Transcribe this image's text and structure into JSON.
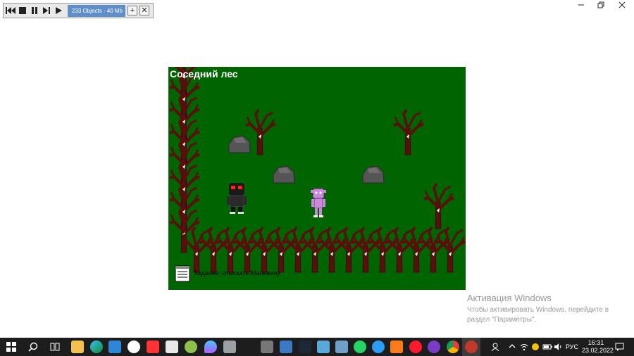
{
  "toolbar": {
    "status_text": "233 Objects - 40 Mb",
    "add_label": "+",
    "close_label": "✕"
  },
  "game": {
    "location_title": "Соседний лес",
    "hint_text": "Задание: отыскать Мальвину"
  },
  "activation": {
    "title": "Активация Windows",
    "line1": "Чтобы активировать Windows, перейдите в",
    "line2": "раздел \"Параметры\"."
  },
  "taskbar": {
    "lang": "РУС",
    "time": "16:31",
    "date": "23.02.2022"
  },
  "colors": {
    "forest": "#006400",
    "tree": "#5a0e0e",
    "rock": "#555555",
    "taskbar": "#1d1d1d"
  }
}
